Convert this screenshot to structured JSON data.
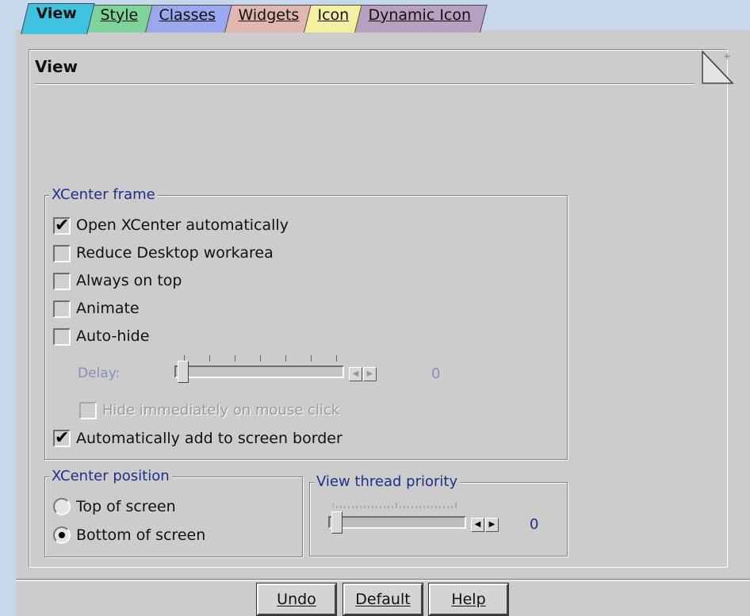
{
  "tabs": [
    {
      "label": "View",
      "color": "#3fc1e0",
      "active": true
    },
    {
      "label": "Style",
      "color": "#7ed39a"
    },
    {
      "label": "Classes",
      "color": "#9aa8f0"
    },
    {
      "label": "Widgets",
      "color": "#e0b8b0"
    },
    {
      "label": "Icon",
      "color": "#f5f0a0"
    },
    {
      "label": "Dynamic Icon",
      "color": "#b8a0c0"
    }
  ],
  "page": {
    "title": "View"
  },
  "xcenter_frame": {
    "legend": "XCenter frame",
    "options": [
      {
        "label": "Open XCenter automatically",
        "checked": true
      },
      {
        "label": "Reduce Desktop workarea",
        "checked": false
      },
      {
        "label": "Always on top",
        "checked": false
      },
      {
        "label": "Animate",
        "checked": false
      },
      {
        "label": "Auto-hide",
        "checked": false
      }
    ],
    "delay": {
      "label": "Delay:",
      "value": "0",
      "enabled": false
    },
    "hide_immediately": {
      "label": "Hide immediately on mouse click",
      "checked": false,
      "enabled": false
    },
    "auto_add": {
      "label": "Automatically add to screen border",
      "checked": true
    }
  },
  "xcenter_position": {
    "legend": "XCenter position",
    "options": [
      {
        "label": "Top of screen",
        "selected": false
      },
      {
        "label": "Bottom of screen",
        "selected": true
      }
    ]
  },
  "thread_priority": {
    "legend": "View thread priority",
    "value": "0"
  },
  "buttons": {
    "undo": "Undo",
    "default": "Default",
    "help": "Help"
  },
  "check_glyph": "✔"
}
